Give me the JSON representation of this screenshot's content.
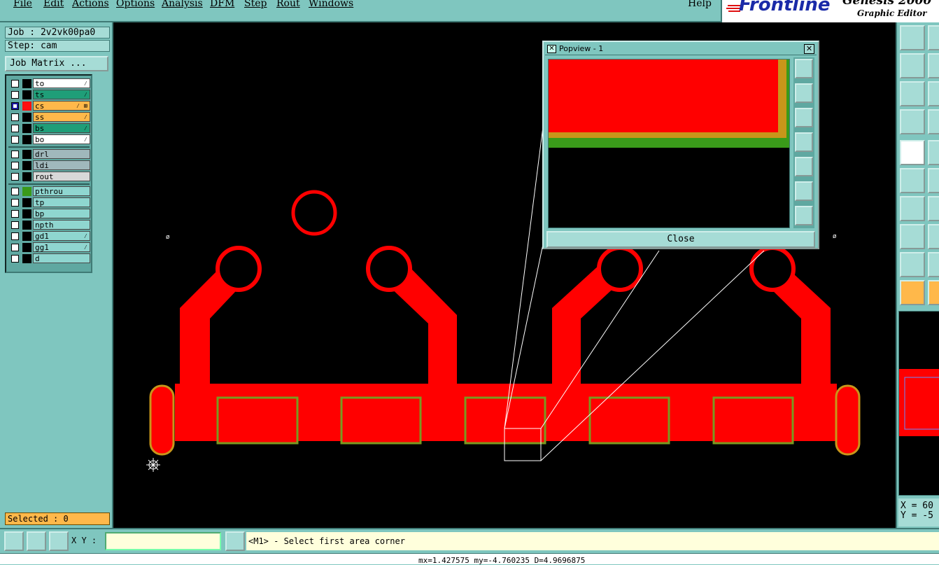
{
  "menu": {
    "items": [
      "File",
      "Edit",
      "Actions",
      "Options",
      "Analysis",
      "DFM",
      "Step",
      "Rout",
      "Windows"
    ],
    "help": "Help"
  },
  "brand": {
    "logo": "Frontline",
    "product": "Genesis 2000",
    "subtitle": "Graphic Editor"
  },
  "job": {
    "job_label": "Job : 2v2vk00pa0",
    "step_label": "Step: cam",
    "matrix_button": "Job Matrix ..."
  },
  "layers": [
    {
      "name": "to",
      "color": "#ffffff",
      "flag": "⁄",
      "checked": false
    },
    {
      "name": "ts",
      "color": "#1f9e78",
      "flag": "⁄",
      "checked": false
    },
    {
      "name": "cs",
      "color": "#ffb84a",
      "flag": "⁄ ⊞",
      "checked": true,
      "swatch": "#ff1010"
    },
    {
      "name": "ss",
      "color": "#ffb84a",
      "flag": "⁄",
      "checked": false
    },
    {
      "name": "bs",
      "color": "#1f9e78",
      "flag": "⁄",
      "checked": false
    },
    {
      "name": "bo",
      "color": "#ffffff",
      "flag": "⁄",
      "checked": false
    },
    {
      "name": "drl",
      "color": "#a0b8bc",
      "flag": "",
      "checked": false
    },
    {
      "name": "ldi",
      "color": "#a0b8bc",
      "flag": "",
      "checked": false
    },
    {
      "name": "rout",
      "color": "#d8d8d8",
      "flag": "",
      "checked": false
    },
    {
      "name": "pthrou",
      "color": "#8fd6d0",
      "flag": "",
      "checked": false,
      "swatch": "#3a9a1a"
    },
    {
      "name": "tp",
      "color": "#8fd6d0",
      "flag": "",
      "checked": false
    },
    {
      "name": "bp",
      "color": "#8fd6d0",
      "flag": "",
      "checked": false
    },
    {
      "name": "npth",
      "color": "#8fd6d0",
      "flag": "",
      "checked": false
    },
    {
      "name": "gd1",
      "color": "#8fd6d0",
      "flag": "⁄",
      "checked": false
    },
    {
      "name": "gg1",
      "color": "#8fd6d0",
      "flag": "⁄",
      "checked": false
    },
    {
      "name": "d",
      "color": "#8fd6d0",
      "flag": "",
      "checked": false
    }
  ],
  "selected": "Selected : 0",
  "popview": {
    "title": "Popview - 1",
    "close_label": "Close",
    "close_x": "✕"
  },
  "coords": {
    "x": "X = 60",
    "y": "Y = -5"
  },
  "bottom": {
    "xy_label": "X Y :",
    "xy_value": "",
    "prompt": "<M1> - Select first area corner",
    "status": "mx=1.427575 my=-4.760235 D=4.9696875"
  },
  "colors": {
    "copper": "#ff0000",
    "pad_outline": "#7a9a20",
    "oval_outline": "#c8961a",
    "canvas": "#000000",
    "panel": "#7fc6bf"
  }
}
